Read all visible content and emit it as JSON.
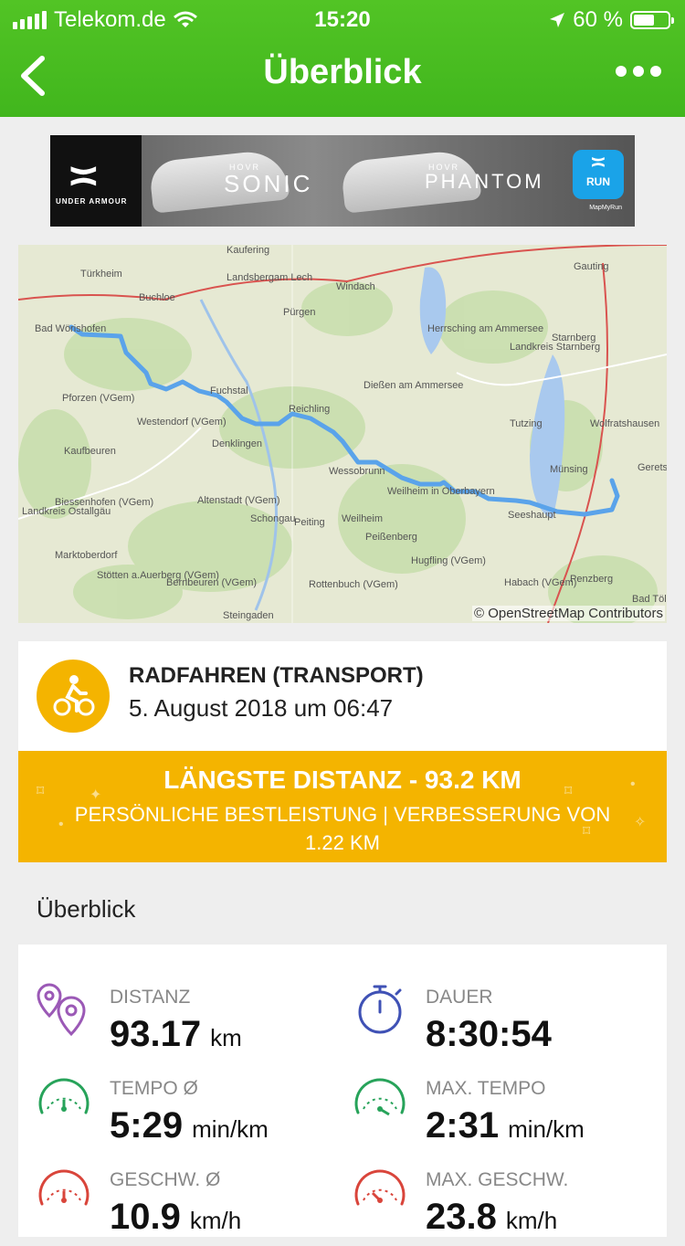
{
  "status": {
    "carrier": "Telekom.de",
    "time": "15:20",
    "battery": "60 %",
    "battery_level": 0.6
  },
  "nav": {
    "title": "Überblick"
  },
  "ad": {
    "brand_text": "UNDER ARMOUR",
    "product1_small": "HOVR",
    "product1": "SONIC",
    "product2_small": "HOVR",
    "product2": "PHANTOM",
    "run_label": "RUN",
    "app_text": "MapMyRun"
  },
  "map": {
    "credit": "© OpenStreetMap Contributors",
    "places": [
      "Kaufering",
      "Türkheim",
      "Landsbergam Lech",
      "Buchloe",
      "Windach",
      "Gauting",
      "Pürgen",
      "Bad Wörishofen",
      "Herrsching am Ammersee",
      "Starnberg",
      "Landkreis Starnberg",
      "Fuchstal",
      "Dießen am Ammersee",
      "Pforzen (VGem)",
      "Reichling",
      "Westendorf (VGem)",
      "Tutzing",
      "Wolfratshausen",
      "Denklingen",
      "Kaufbeuren",
      "Wessobrunn",
      "Münsing",
      "Geretsri",
      "Biessenhofen (VGem)",
      "Weilheim in Oberbayern",
      "Altenstadt (VGem)",
      "Landkreis Ostallgäu",
      "Schongau",
      "Peiting",
      "Weilheim",
      "Seeshaupt",
      "Peißenberg",
      "Marktoberdorf",
      "Hugfling (VGem)",
      "Stötten a.Auerberg (VGem)",
      "Bernbeuren (VGem)",
      "Rottenbuch (VGem)",
      "Habach (VGem)",
      "Penzberg",
      "Steingaden",
      "Bad Tölz"
    ]
  },
  "activity": {
    "title": "RADFAHREN (TRANSPORT)",
    "date": "5. August 2018 um 06:47",
    "accent": "#f4b400"
  },
  "achievement": {
    "headline": "LÄNGSTE DISTANZ - 93.2 KM",
    "sub": "PERSÖNLICHE BESTLEISTUNG  |  VERBESSERUNG VON 1.22 KM"
  },
  "section_title": "Überblick",
  "stats": [
    {
      "label": "DISTANZ",
      "value": "93.17",
      "unit": "km",
      "icon": "location-pins-icon"
    },
    {
      "label": "DAUER",
      "value": "8:30:54",
      "unit": "",
      "icon": "stopwatch-icon"
    },
    {
      "label": "TEMPO Ø",
      "value": "5:29",
      "unit": "min/km",
      "icon": "speedometer-icon"
    },
    {
      "label": "MAX. TEMPO",
      "value": "2:31",
      "unit": "min/km",
      "icon": "speedometer-icon"
    },
    {
      "label": "GESCHW. Ø",
      "value": "10.9",
      "unit": "km/h",
      "icon": "speedometer-red-icon"
    },
    {
      "label": "MAX. GESCHW.",
      "value": "23.8",
      "unit": "km/h",
      "icon": "speedometer-red-icon"
    }
  ]
}
